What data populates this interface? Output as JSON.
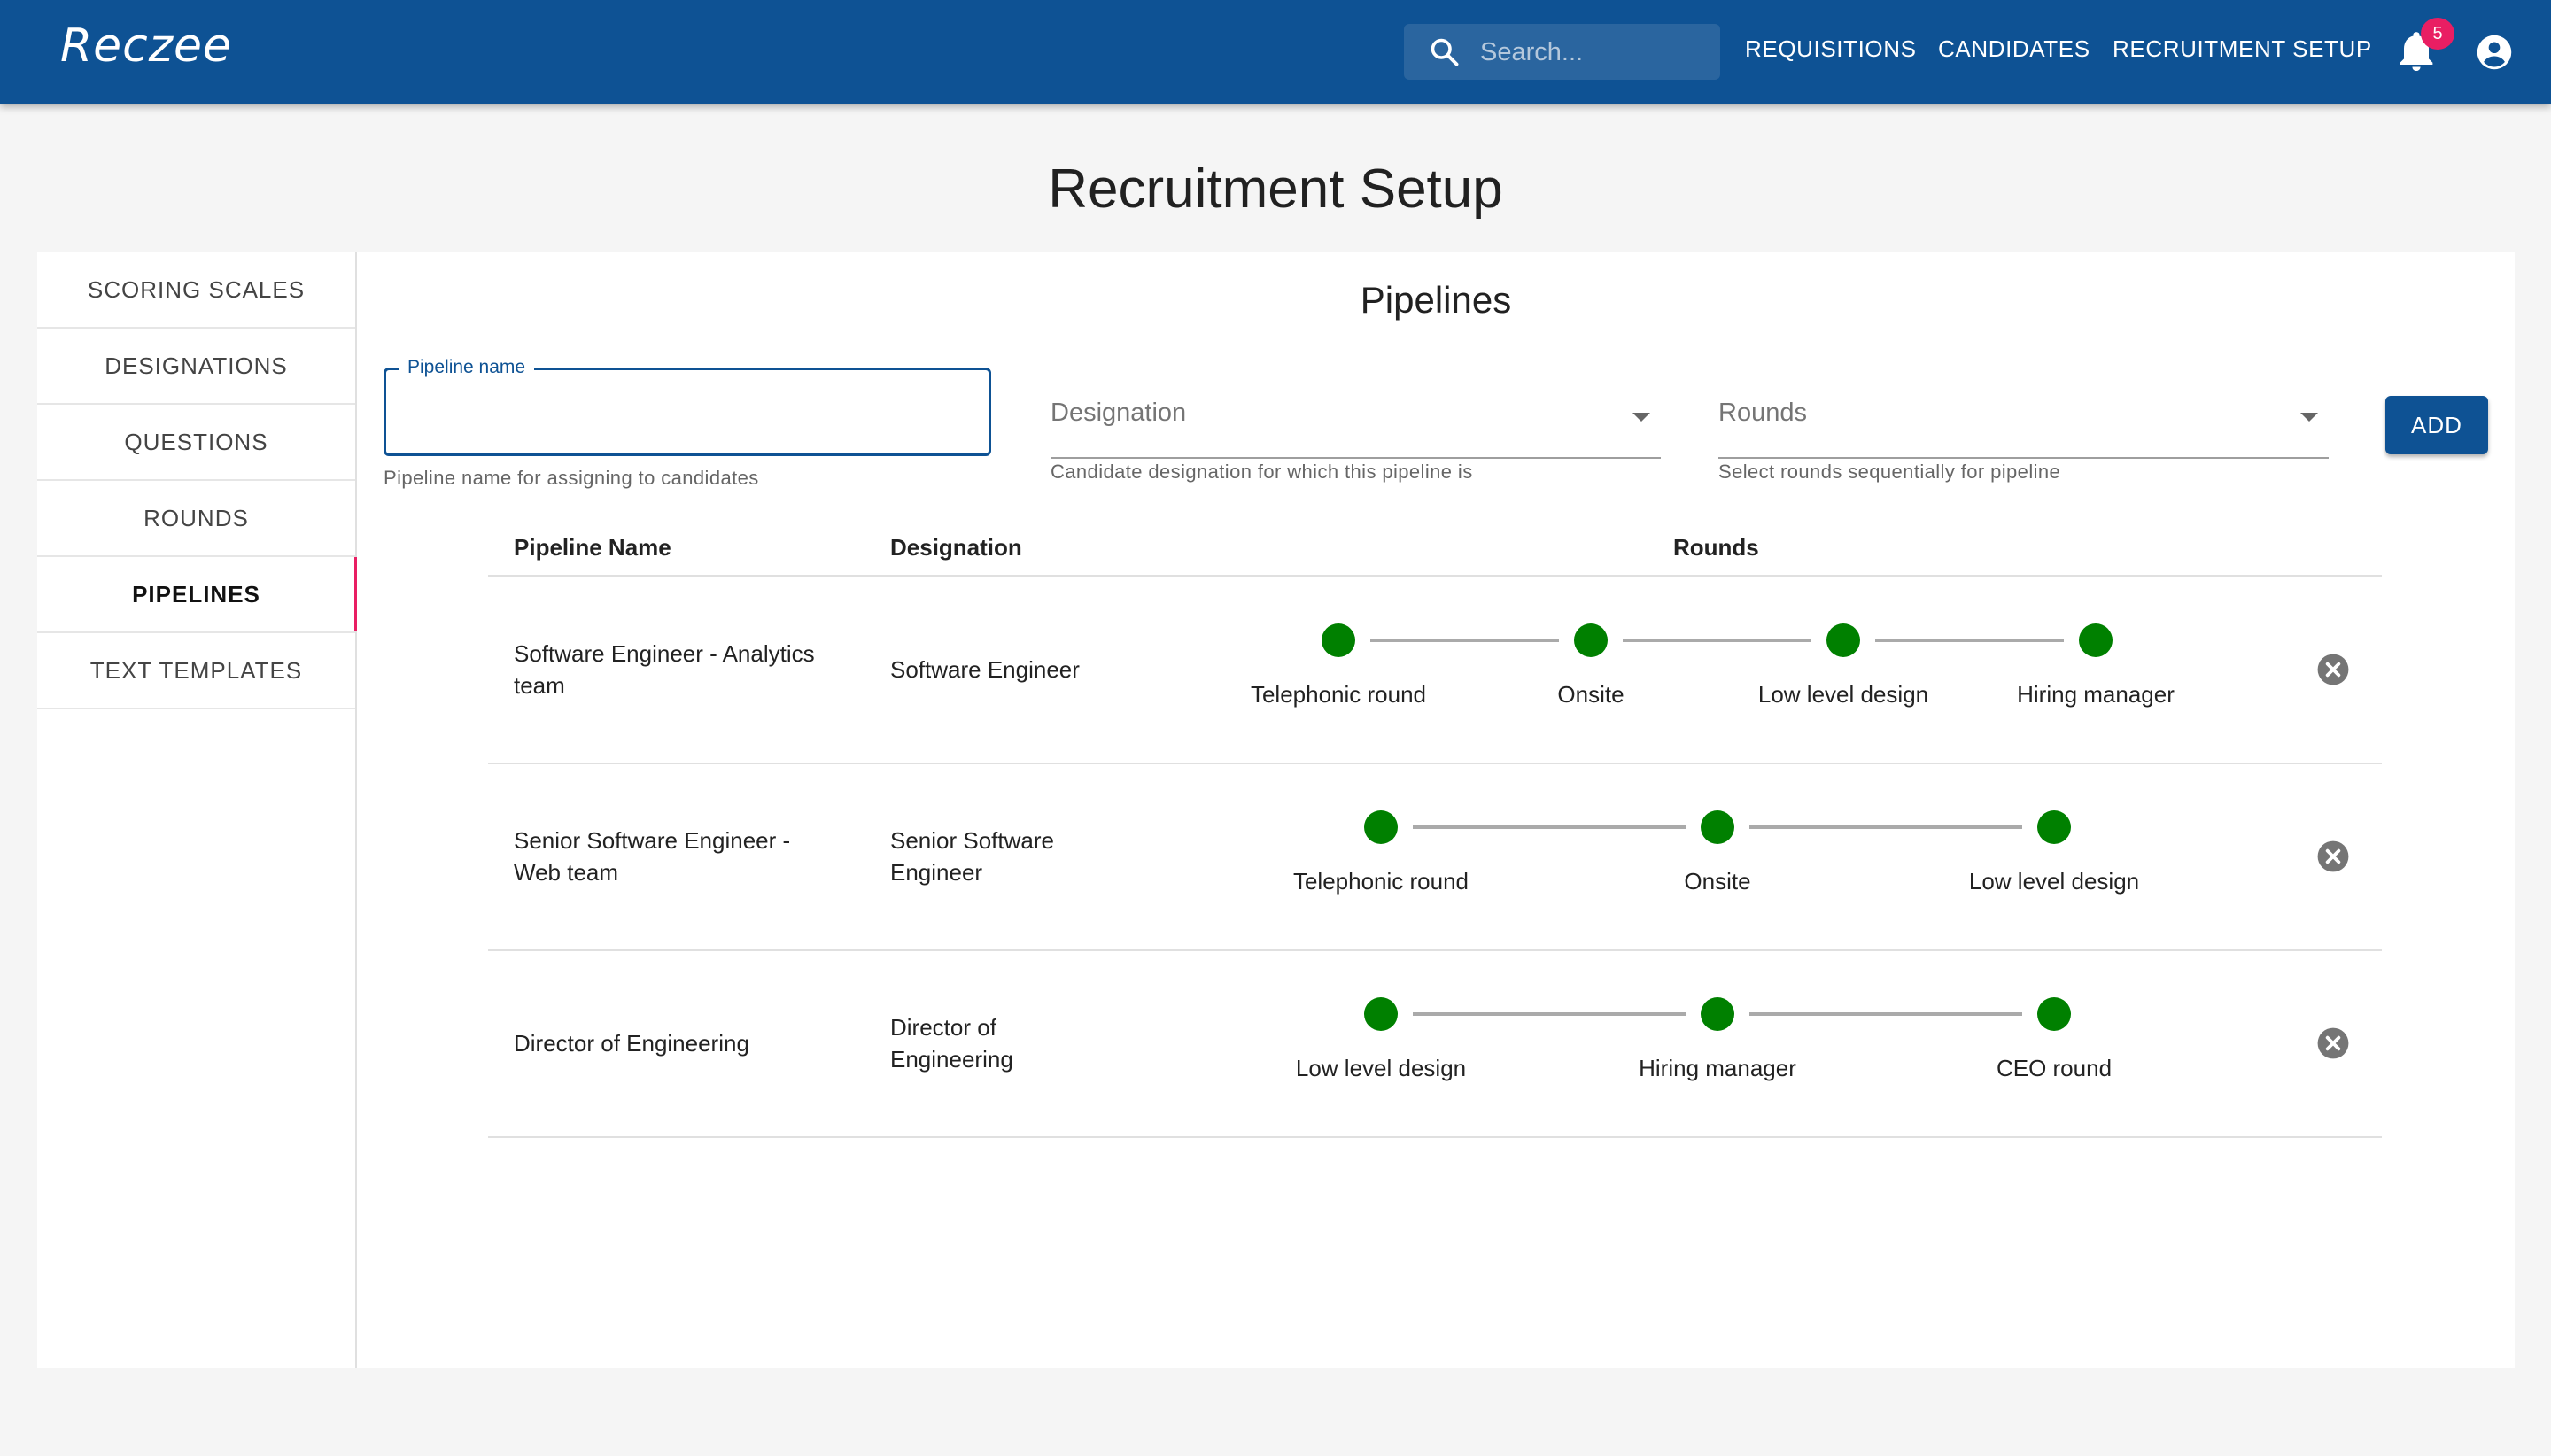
{
  "app": {
    "logo": "Reczee"
  },
  "search": {
    "placeholder": "Search..."
  },
  "nav": {
    "requisitions": "REQUISITIONS",
    "candidates": "CANDIDATES",
    "recruitment_setup": "RECRUITMENT SETUP"
  },
  "notifications": {
    "count": "5"
  },
  "page": {
    "title": "Recruitment Setup"
  },
  "sidebar": {
    "items": [
      {
        "label": "SCORING SCALES"
      },
      {
        "label": "DESIGNATIONS"
      },
      {
        "label": "QUESTIONS"
      },
      {
        "label": "ROUNDS"
      },
      {
        "label": "PIPELINES",
        "active": true
      },
      {
        "label": "TEXT TEMPLATES"
      }
    ]
  },
  "main": {
    "title": "Pipelines",
    "form": {
      "pipeline_name_label": "Pipeline name",
      "pipeline_name_value": "",
      "pipeline_name_helper": "Pipeline name for assigning to candidates",
      "designation_placeholder": "Designation",
      "designation_helper": "Candidate designation for which this pipeline is",
      "rounds_placeholder": "Rounds",
      "rounds_helper": "Select rounds sequentially for pipeline",
      "add_label": "ADD"
    },
    "table": {
      "headers": {
        "name": "Pipeline Name",
        "designation": "Designation",
        "rounds": "Rounds"
      },
      "rows": [
        {
          "name_lines": [
            "Software Engineer - Analytics",
            "team"
          ],
          "designation_lines": [
            "Software Engineer"
          ],
          "rounds": [
            "Telephonic round",
            "Onsite",
            "Low level design",
            "Hiring manager"
          ]
        },
        {
          "name_lines": [
            "Senior Software Engineer -",
            "Web team"
          ],
          "designation_lines": [
            "Senior Software",
            "Engineer"
          ],
          "rounds": [
            "Telephonic round",
            "Onsite",
            "Low level design"
          ]
        },
        {
          "name_lines": [
            "Director of Engineering"
          ],
          "designation_lines": [
            "Director of",
            "Engineering"
          ],
          "rounds": [
            "Low level design",
            "Hiring manager",
            "CEO round"
          ]
        }
      ]
    }
  },
  "colors": {
    "primary": "#0e5294",
    "step_complete": "#008000",
    "badge": "#e91e63",
    "active_indicator": "#e91e63"
  }
}
